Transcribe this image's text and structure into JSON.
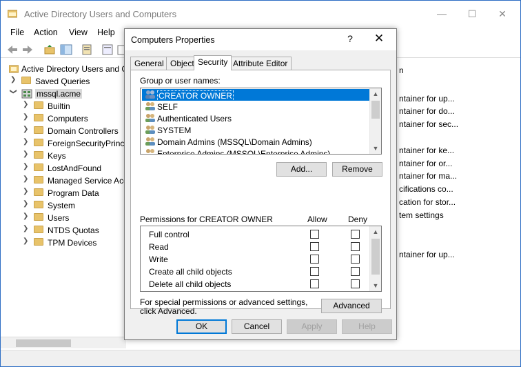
{
  "window": {
    "title": "Active Directory Users and Computers",
    "min": "—",
    "max": "☐",
    "close": "✕"
  },
  "menu": [
    "File",
    "Action",
    "View",
    "Help"
  ],
  "tree": {
    "root": "Active Directory Users and C",
    "saved_queries": "Saved Queries",
    "domain": "mssql.acme",
    "children": [
      "Builtin",
      "Computers",
      "Domain Controllers",
      "ForeignSecurityPrinci",
      "Keys",
      "LostAndFound",
      "Managed Service Acc",
      "Program Data",
      "System",
      "Users",
      "NTDS Quotas",
      "TPM Devices"
    ]
  },
  "right_pane": {
    "header": "n",
    "rows": [
      "ntainer for up...",
      "ntainer for do...",
      "ntainer for sec...",
      "ntainer for ke...",
      "ntainer for or...",
      "ntainer for ma...",
      "cifications co...",
      "cation for stor...",
      "tem settings",
      "ntainer for up..."
    ]
  },
  "dialog": {
    "title": "Computers Properties",
    "help": "?",
    "close": "✕",
    "tabs": [
      "General",
      "Object",
      "Security",
      "Attribute Editor"
    ],
    "group_label": "Group or user names:",
    "principals": [
      "CREATOR OWNER",
      "SELF",
      "Authenticated Users",
      "SYSTEM",
      "Domain Admins (MSSQL\\Domain Admins)",
      "Enterprise Admins (MSSQL\\Enterprise Admins)"
    ],
    "add_label": "Add...",
    "remove_label": "Remove",
    "perm_label": "Permissions for CREATOR OWNER",
    "allow_label": "Allow",
    "deny_label": "Deny",
    "permissions": [
      "Full control",
      "Read",
      "Write",
      "Create all child objects",
      "Delete all child objects"
    ],
    "special_text": "For special permissions or advanced settings, click Advanced.",
    "advanced_label": "Advanced",
    "ok_label": "OK",
    "cancel_label": "Cancel",
    "apply_label": "Apply",
    "help_label": "Help"
  }
}
